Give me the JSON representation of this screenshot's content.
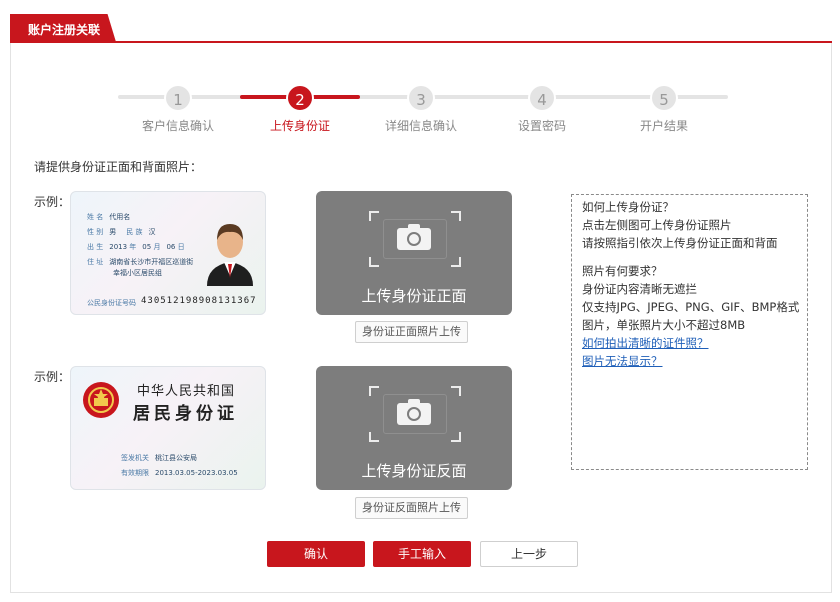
{
  "header": {
    "tab_label": "账户注册关联"
  },
  "steps": [
    {
      "num": "1",
      "label": "客户信息确认"
    },
    {
      "num": "2",
      "label": "上传身份证"
    },
    {
      "num": "3",
      "label": "详细信息确认"
    },
    {
      "num": "4",
      "label": "设置密码"
    },
    {
      "num": "5",
      "label": "开户结果"
    }
  ],
  "prompt": "请提供身份证正面和背面照片：",
  "example_label": "示例：",
  "front": {
    "card": {
      "name_key": "姓 名",
      "name_val": "代用名",
      "sex_key": "性 别",
      "sex_val": "男",
      "nation_key": "民 族",
      "nation_val": "汉",
      "birth_key": "出 生",
      "birth_year": "2013",
      "birth_year_unit": "年",
      "birth_month": "05",
      "birth_month_unit": "月",
      "birth_day": "06",
      "birth_day_unit": "日",
      "addr_key": "住 址",
      "addr_line1": "湖南省长沙市开福区巡道街",
      "addr_line2": "幸福小区居民组",
      "id_key": "公民身份证号码",
      "id_number": "430512198908131367"
    },
    "upload_text": "上传身份证正面",
    "button_label": "身份证正面照片上传"
  },
  "back": {
    "card": {
      "country": "中华人民共和国",
      "title": "居民身份证",
      "authority_key": "签发机关",
      "authority_val": "桃江县公安局",
      "valid_key": "有效期限",
      "valid_val": "2013.03.05-2023.03.05"
    },
    "upload_text": "上传身份证反面",
    "button_label": "身份证反面照片上传"
  },
  "help": {
    "q1": "如何上传身份证？",
    "a1_1": "点击左侧图可上传身份证照片",
    "a1_2": "请按照指引依次上传身份证正面和背面",
    "q2": "照片有何要求？",
    "a2_1": "身份证内容清晰无遮拦",
    "a2_2": "仅支持JPG、JPEG、PNG、GIF、BMP格式",
    "a2_3": "图片，单张照片大小不超过8MB",
    "link1": "如何拍出清晰的证件照？",
    "link2": "图片无法显示？"
  },
  "actions": {
    "confirm": "确认",
    "manual": "手工输入",
    "prev": "上一步"
  },
  "colors": {
    "accent": "#c8161d",
    "upload_bg": "#7d7d7d",
    "link": "#1f5fb8"
  }
}
